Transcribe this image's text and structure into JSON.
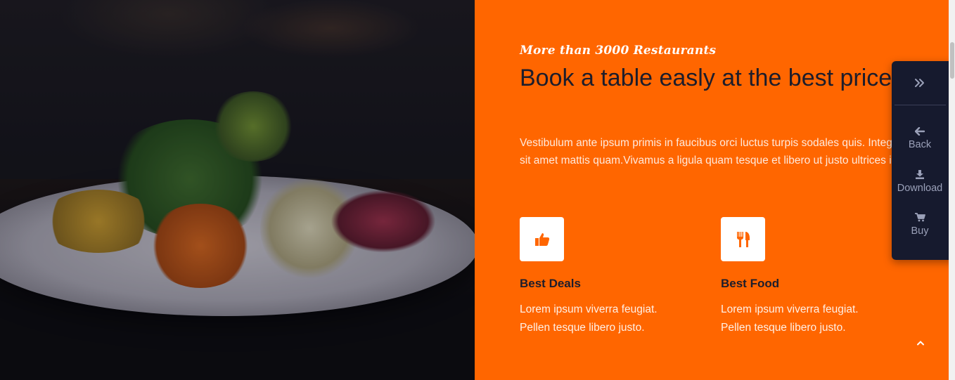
{
  "hero": {
    "eyebrow": "More than 3000 Restaurants",
    "headline": "Book a table easly at the best price",
    "lead": "Vestibulum ante ipsum primis in faucibus orci luctus turpis sodales quis. Integer sit amet mattis quam.Vivamus a ligula quam tesque et libero ut justo ultrices in."
  },
  "features": [
    {
      "title": "Best Deals",
      "text_line1": "Lorem ipsum viverra feugiat.",
      "text_line2": "Pellen tesque libero justo.",
      "icon": "thumbs-up-icon"
    },
    {
      "title": "Best Food",
      "text_line1": "Lorem ipsum viverra feugiat.",
      "text_line2": "Pellen tesque libero justo.",
      "icon": "fork-knife-icon"
    }
  ],
  "side_panel": {
    "items": [
      {
        "label": "Back",
        "icon": "arrow-left-icon"
      },
      {
        "label": "Download",
        "icon": "download-icon"
      },
      {
        "label": "Buy",
        "icon": "cart-icon"
      }
    ]
  },
  "colors": {
    "accent": "#ff6600",
    "panel": "#161a2e",
    "heading": "#1d1d2b"
  }
}
